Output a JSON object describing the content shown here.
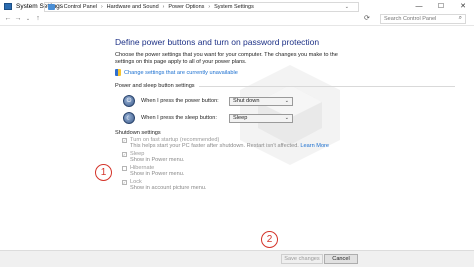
{
  "window": {
    "title": "System Settings",
    "controls": {
      "minimize": "—",
      "maximize": "☐",
      "close": "✕"
    }
  },
  "nav": {
    "back": "←",
    "forward": "→",
    "up": "↑",
    "breadcrumbs": [
      "Control Panel",
      "Hardware and Sound",
      "Power Options",
      "System Settings"
    ],
    "search_placeholder": "Search Control Panel",
    "refresh": "⟳"
  },
  "page": {
    "heading": "Define power buttons and turn on password protection",
    "description": "Choose the power settings that you want for your computer. The changes you make to the settings on this page apply to all of your power plans.",
    "change_link": "Change settings that are currently unavailable"
  },
  "power_section": {
    "title": "Power and sleep button settings",
    "rows": [
      {
        "label": "When I press the power button:",
        "value": "Shut down"
      },
      {
        "label": "When I press the sleep button:",
        "value": "Sleep"
      }
    ]
  },
  "shutdown_section": {
    "title": "Shutdown settings",
    "options": [
      {
        "label": "Turn on fast startup (recommended)",
        "checked": true,
        "sub": "This helps start your PC faster after shutdown. Restart isn't affected.",
        "sub_link": "Learn More"
      },
      {
        "label": "Sleep",
        "checked": true,
        "sub": "Show in Power menu."
      },
      {
        "label": "Hibernate",
        "checked": false,
        "sub": "Show in Power menu."
      },
      {
        "label": "Lock",
        "checked": true,
        "sub": "Show in account picture menu."
      }
    ]
  },
  "annotations": {
    "one": "1",
    "two": "2"
  },
  "footer": {
    "save": "Save changes",
    "cancel": "Cancel"
  },
  "colors": {
    "heading": "#1e3287",
    "link": "#1a6fd0",
    "annotation": "#d4342a"
  }
}
